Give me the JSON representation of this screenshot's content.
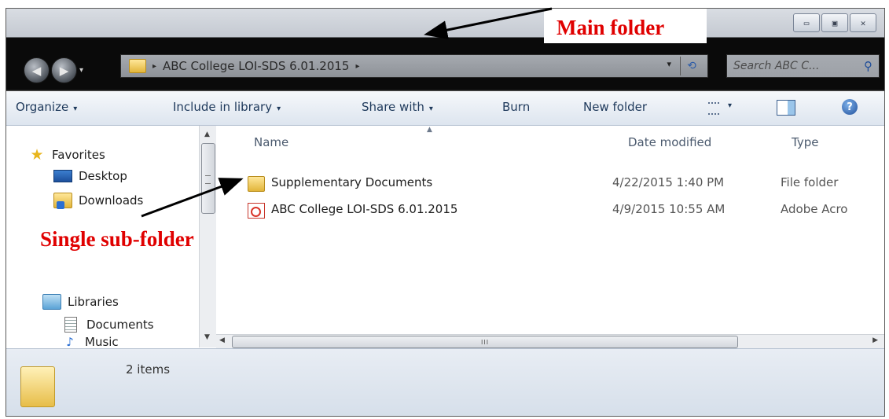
{
  "window": {
    "caption_buttons": [
      "minimize-icon",
      "maximize-icon",
      "close-icon"
    ],
    "caption_glyphs": [
      "▭",
      "▣",
      "✕"
    ]
  },
  "nav": {
    "back_glyph": "◀",
    "forward_glyph": "▶",
    "drop_glyph": "▾"
  },
  "address": {
    "path": "ABC College LOI-SDS 6.01.2015",
    "sep_glyph": "▸",
    "drop_glyph": "▾",
    "refresh_glyph": "⟲"
  },
  "search": {
    "placeholder": "Search ABC C...",
    "icon_glyph": "⚲"
  },
  "toolbar": {
    "organize": "Organize",
    "include": "Include in library",
    "share": "Share with",
    "burn": "Burn",
    "new_folder": "New folder",
    "caret_glyph": "▾",
    "help_glyph": "?"
  },
  "sidebar": {
    "favorites": "Favorites",
    "desktop": "Desktop",
    "downloads": "Downloads",
    "libraries": "Libraries",
    "documents": "Documents",
    "music": "Music",
    "star_glyph": "★",
    "music_glyph": "♪"
  },
  "columns": {
    "name": "Name",
    "date": "Date modified",
    "type": "Type",
    "sort_glyph": "▲"
  },
  "files": [
    {
      "name": "Supplementary Documents",
      "date": "4/22/2015 1:40 PM",
      "type": "File folder",
      "icon": "folder-icon"
    },
    {
      "name": "ABC College LOI-SDS 6.01.2015",
      "date": "4/9/2015 10:55 AM",
      "type": "Adobe Acro",
      "icon": "pdf-icon"
    }
  ],
  "scroll": {
    "up_glyph": "▲",
    "down_glyph": "▼",
    "left_glyph": "◀",
    "right_glyph": "▶",
    "grip": "III"
  },
  "status": {
    "count": "2 items"
  },
  "annotations": {
    "main_folder": "Main folder",
    "sub_folder": "Single sub-folder"
  },
  "colors": {
    "annotation": "#e00000",
    "titlebar": "#0a0a0a",
    "toolbar_text": "#1e395b"
  }
}
